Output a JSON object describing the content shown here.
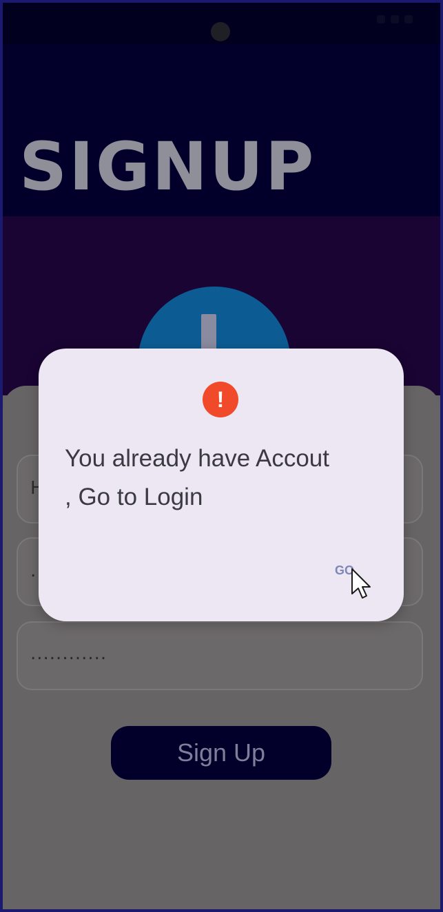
{
  "header": {
    "title": "SIGNUP"
  },
  "form": {
    "field1_value": "H",
    "field2_value": ".",
    "password_value": "............",
    "signup_label": "Sign Up"
  },
  "dialog": {
    "icon": "exclamation-icon",
    "icon_symbol": "!",
    "message_line1": "You already have Accout",
    "message_line2": ", Go to Login",
    "action_label": "GO"
  },
  "colors": {
    "header_bg": "#02002a",
    "band_bg": "#1a0433",
    "card_bg": "#676465",
    "dialog_bg": "#ece7f3",
    "alert_icon": "#f04a2a",
    "button_bg": "#02002a"
  }
}
